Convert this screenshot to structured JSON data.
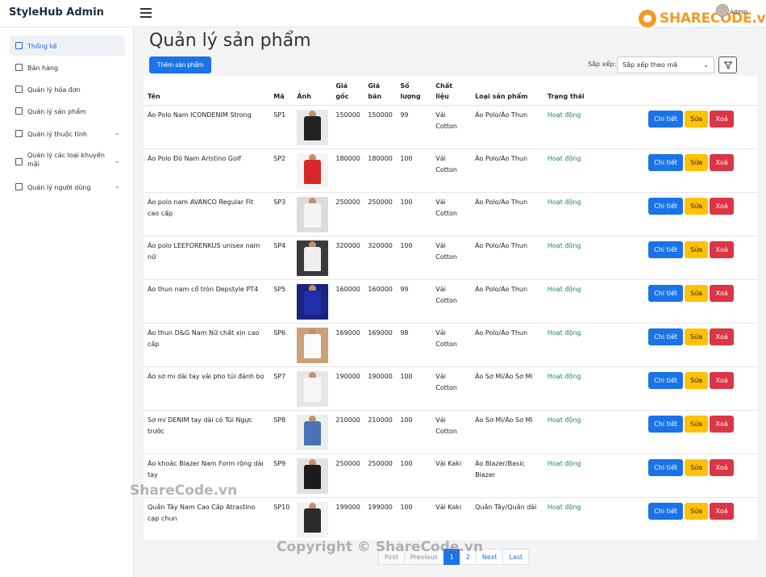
{
  "app": {
    "brand": "StyleHub Admin",
    "admin_name": "Admin"
  },
  "watermark": {
    "logo_text": "SHARECODE.vn",
    "left_text": "ShareCode.vn",
    "bottom_text": "Copyright © ShareCode.vn"
  },
  "sidebar": {
    "items": [
      {
        "label": "Thống kê",
        "icon": "chart-icon",
        "expandable": false
      },
      {
        "label": "Bán hàng",
        "icon": "cart-icon",
        "expandable": false
      },
      {
        "label": "Quản lý hóa đơn",
        "icon": "receipt-icon",
        "expandable": false
      },
      {
        "label": "Quản lý sản phẩm",
        "icon": "box-icon",
        "expandable": false
      },
      {
        "label": "Quản lý thuộc tính",
        "icon": "tag-icon",
        "expandable": true
      },
      {
        "label": "Quản lý các loại khuyến mãi",
        "icon": "discount-icon",
        "expandable": true
      },
      {
        "label": "Quản lý người dùng",
        "icon": "users-icon",
        "expandable": true
      }
    ]
  },
  "main": {
    "title": "Quản lý sản phẩm",
    "add_button": "Thêm sản phẩm",
    "sort_label": "Sắp xếp:",
    "sort_value": "Sắp xếp theo mã"
  },
  "table": {
    "headers": [
      "Tên",
      "Mã",
      "Ảnh",
      "Giá gốc",
      "Giá bán",
      "Số lượng",
      "Chất liệu",
      "Loại sản phẩm",
      "Trạng thái",
      ""
    ],
    "action_labels": {
      "detail": "Chi tiết",
      "edit": "Sửa",
      "delete": "Xoá"
    },
    "rows": [
      {
        "name": "Áo Polo Nam ICONDENIM Strong",
        "code": "SP1",
        "cost": "150000",
        "price": "150000",
        "qty": "99",
        "material": "Vải Cotton",
        "type": "Áo Polo/Áo Thun",
        "status": "Hoạt động",
        "img_color": "#222222",
        "bg": "#e8e8e8"
      },
      {
        "name": "Áo Polo Đỏ Nam Aristino Golf",
        "code": "SP2",
        "cost": "180000",
        "price": "180000",
        "qty": "100",
        "material": "Vải Cotton",
        "type": "Áo Polo/Áo Thun",
        "status": "Hoạt động",
        "img_color": "#d62828",
        "bg": "#f4f4f4"
      },
      {
        "name": "Áo polo nam AVANCO Regular Fit cao cấp",
        "code": "SP3",
        "cost": "250000",
        "price": "250000",
        "qty": "100",
        "material": "Vải Cotton",
        "type": "Áo Polo/Áo Thun",
        "status": "Hoạt động",
        "img_color": "#f5f5f5",
        "bg": "#dcdcdc"
      },
      {
        "name": "Áo polo LEEFORENKUS unisex nam nữ",
        "code": "SP4",
        "cost": "320000",
        "price": "320000",
        "qty": "100",
        "material": "Vải Cotton",
        "type": "Áo Polo/Áo Thun",
        "status": "Hoạt động",
        "img_color": "#efefef",
        "bg": "#3a3a3a"
      },
      {
        "name": "Áo thun nam cổ tròn Depstyle PT4",
        "code": "SP5",
        "cost": "160000",
        "price": "160000",
        "qty": "99",
        "material": "Vải Cotton",
        "type": "Áo Polo/Áo Thun",
        "status": "Hoạt động",
        "img_color": "#1f2fa8",
        "bg": "#1a237e"
      },
      {
        "name": "Áo thun D&G Nam Nữ chất xịn cao cấp",
        "code": "SP6",
        "cost": "169000",
        "price": "169000",
        "qty": "98",
        "material": "Vải Cotton",
        "type": "Áo Polo/Áo Thun",
        "status": "Hoạt động",
        "img_color": "#fafafa",
        "bg": "#c9a27a"
      },
      {
        "name": "Áo sơ mi dài tay vải pho túi đánh bọ",
        "code": "SP7",
        "cost": "190000",
        "price": "190000",
        "qty": "100",
        "material": "Vải Cotton",
        "type": "Áo Sơ Mi/Áo Sơ Mi",
        "status": "Hoạt động",
        "img_color": "#f7f7f7",
        "bg": "#e6e6e6"
      },
      {
        "name": "Sơ mi DENIM tay dài có Túi Ngực trước",
        "code": "SP8",
        "cost": "210000",
        "price": "210000",
        "qty": "100",
        "material": "Vải Cotton",
        "type": "Áo Sơ Mi/Áo Sơ Mi",
        "status": "Hoạt động",
        "img_color": "#4a73b5",
        "bg": "#eeeeee"
      },
      {
        "name": "Áo khoác Blazer Nam Form rộng dài tay",
        "code": "SP9",
        "cost": "250000",
        "price": "250000",
        "qty": "100",
        "material": "Vải Kaki",
        "type": "Áo Blazer/Basic Blazer",
        "status": "Hoạt động",
        "img_color": "#1c1c1c",
        "bg": "#e2e2e2"
      },
      {
        "name": "Quần Tây Nam Cao Cấp Atrastino cạp chun",
        "code": "SP10",
        "cost": "199000",
        "price": "199000",
        "qty": "100",
        "material": "Vải Kaki",
        "type": "Quần Tây/Quần dài",
        "status": "Hoạt động",
        "img_color": "#2b2b2b",
        "bg": "#f2f2f2"
      }
    ]
  },
  "pagination": {
    "first": "First",
    "previous": "Previous",
    "pages": [
      "1",
      "2"
    ],
    "current": "1",
    "next": "Next",
    "last": "Last"
  }
}
